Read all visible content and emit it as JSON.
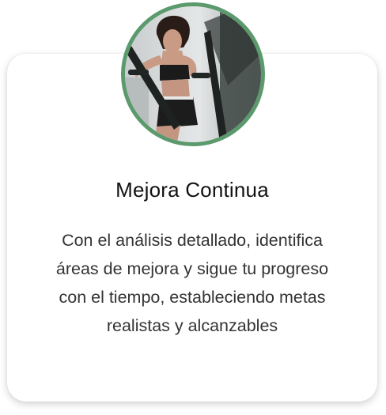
{
  "card": {
    "title": "Mejora Continua",
    "description": "Con el análisis detallado, identifica áreas de mejora y sigue tu progreso con el tiempo, estableciendo metas realistas y alcanzables",
    "avatar_icon": "woman-on-elliptical-photo",
    "accent_color": "#5b9a6c"
  }
}
